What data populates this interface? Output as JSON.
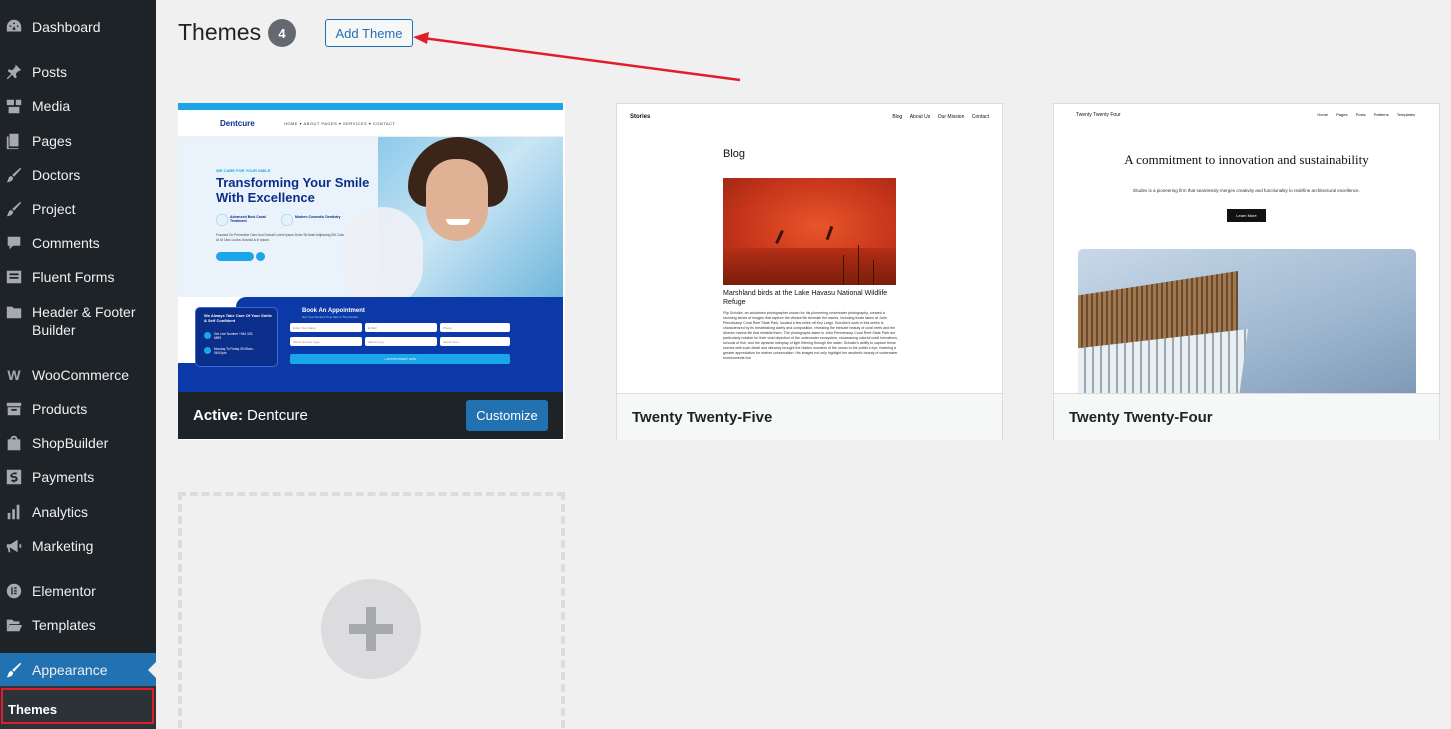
{
  "sidebar": {
    "items": [
      {
        "label": "Dashboard",
        "icon": "dashboard-icon"
      },
      {
        "label": "Posts",
        "icon": "pin-icon"
      },
      {
        "label": "Media",
        "icon": "media-icon"
      },
      {
        "label": "Pages",
        "icon": "pages-icon"
      },
      {
        "label": "Doctors",
        "icon": "brush-icon"
      },
      {
        "label": "Project",
        "icon": "brush-icon"
      },
      {
        "label": "Comments",
        "icon": "comment-icon"
      },
      {
        "label": "Fluent Forms",
        "icon": "forms-icon"
      },
      {
        "label": "Header & Footer Builder",
        "icon": "folder-icon"
      },
      {
        "label": "WooCommerce",
        "icon": "woo-icon"
      },
      {
        "label": "Products",
        "icon": "archive-icon"
      },
      {
        "label": "ShopBuilder",
        "icon": "bag-icon"
      },
      {
        "label": "Payments",
        "icon": "dollar-icon"
      },
      {
        "label": "Analytics",
        "icon": "bar-chart-icon"
      },
      {
        "label": "Marketing",
        "icon": "megaphone-icon"
      },
      {
        "label": "Elementor",
        "icon": "elementor-icon"
      },
      {
        "label": "Templates",
        "icon": "folder-open-icon"
      },
      {
        "label": "Appearance",
        "icon": "paintbrush-icon"
      }
    ],
    "submenu": {
      "themes": "Themes"
    }
  },
  "header": {
    "title": "Themes",
    "count": "4",
    "add_button": "Add Theme"
  },
  "themes": {
    "active": {
      "prefix": "Active:",
      "name": "Dentcure",
      "customize": "Customize",
      "preview": {
        "logo": "Dentcure",
        "nav": "HOME ▾   ABOUT   PAGES ▾   SERVICES ▾   CONTACT",
        "eyebrow": "WE CARE FOR YOUR SMILE",
        "headline": "Transforming Your Smile With Excellence",
        "feature1": "Advanced Best Canal Treatment",
        "feature2": "Modern Cosmetic Dentistry",
        "para": "Focused On Preventive Care And Overall Lorem Ipsum Dolor Sit Amet Adipiscing Elit. Duis At Ut Litus Luctus Gravida A In Ipsum.",
        "card_title": "We Always Take Care Of Your Smile & Self Confident",
        "card_line1": "Get Live Number +944 333 6899",
        "card_line2": "Monday To Friday 09:00am - 06:00pm",
        "book": "Book An Appointment",
        "book_sub": "Get Your Desired Time Slot In The Dentist",
        "f_name": "Enter Your Name",
        "f_mail": "E-Mail",
        "f_phone": "Phone",
        "f_service": "Select Service Type",
        "f_date": "dd/mm/yyyy",
        "f_time": "Select Time",
        "submit": "+ APPOINTMENT NOW"
      }
    },
    "tt5": {
      "name": "Twenty Twenty-Five",
      "site": "Stories",
      "nav": [
        "Blog",
        "About Us",
        "Our Mission",
        "Contact"
      ],
      "heading": "Blog",
      "caption": "Marshland birds at the Lake Havasu National Wildlife Refuge",
      "text": "Flip Schulke, an acclaimed photographer known for his pioneering underwater photography, created a stunning series of images that capture the vibrant life beneath the waves, including those taken at John Pennekamp Coral Reef State Park, located a few miles off Key Largo. Schulke's work in this series is characterized by its breathtaking clarity and composition, revealing the intricate beauty of coral reefs and the diverse marine life that inhabits them. The photographs taken in John Pennekamp Coral Reef State Park are particularly notable for their vivid depiction of the underwater ecosystem, showcasing colorful coral formations, schools of fish, and the dynamic interplay of light filtering through the water. Schulke's ability to capture these scenes with such detail and vibrancy brought the hidden wonders of the ocean to the public's eye, fostering a greater appreciation for marine conservation. His images not only highlight the aesthetic beauty of underwater environments but"
    },
    "tt4": {
      "name": "Twenty Twenty-Four",
      "site": "Twenty Twenty Four",
      "nav": [
        "Home",
        "Pages",
        "Posts",
        "Patterns",
        "Templates"
      ],
      "heading": "A commitment to innovation and sustainability",
      "text": "Études is a pioneering firm that seamlessly merges creativity and functionality to redefine architectural excellence.",
      "button": "Learn More"
    }
  },
  "colors": {
    "sidebar_bg": "#1d2327",
    "accent": "#2271b1",
    "annotation": "#e11d2a"
  }
}
